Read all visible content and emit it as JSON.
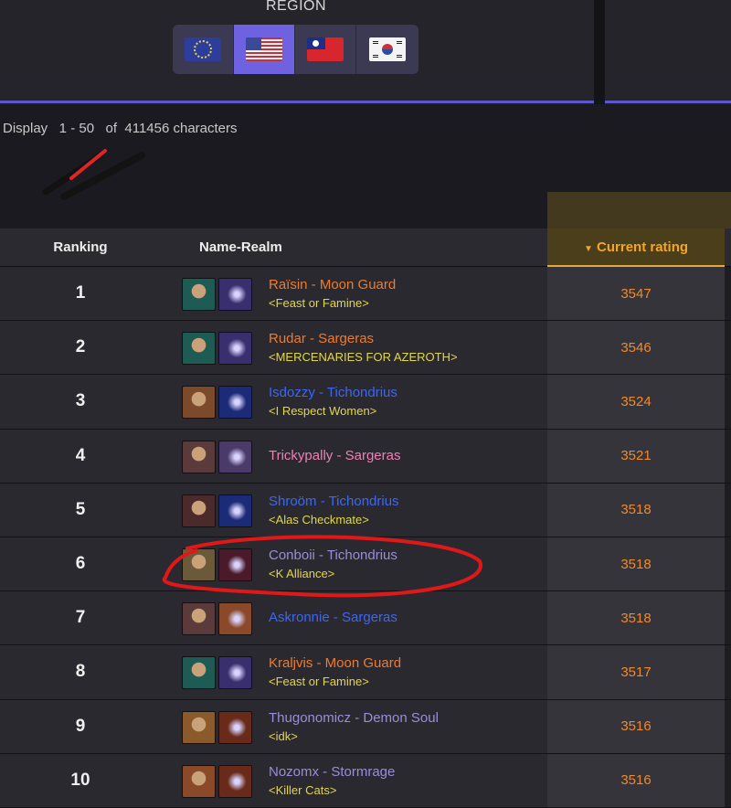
{
  "region": {
    "title": "REGION",
    "options": [
      {
        "code": "EU",
        "icon": "eu-flag-icon",
        "active": false
      },
      {
        "code": "US",
        "icon": "us-flag-icon",
        "active": true
      },
      {
        "code": "TW",
        "icon": "tw-flag-icon",
        "active": false
      },
      {
        "code": "KR",
        "icon": "kr-flag-icon",
        "active": false
      }
    ]
  },
  "display": {
    "text": "Display   1 - 50   of  411456 characters"
  },
  "table": {
    "headers": {
      "ranking": "Ranking",
      "name_realm": "Name-Realm",
      "rating": "Current rating"
    },
    "rows": [
      {
        "rank": "1",
        "name": "Raïsin - Moon Guard",
        "guild": "<Feast or Famine>",
        "rating": "3547",
        "color": "#f07a2c",
        "p1": "#1f5b55",
        "p2": "#3a2f6e"
      },
      {
        "rank": "2",
        "name": "Rudar - Sargeras",
        "guild": "<MERCENARIES FOR AZEROTH>",
        "rating": "3546",
        "color": "#f07a2c",
        "p1": "#1f5b55",
        "p2": "#3a2f6e"
      },
      {
        "rank": "3",
        "name": "Isdozzy - Tichondrius",
        "guild": "<I Respect Women>",
        "rating": "3524",
        "color": "#3d67f0",
        "p1": "#7a4a2a",
        "p2": "#1c2b78"
      },
      {
        "rank": "4",
        "name": "Trickypally - Sargeras",
        "guild": "",
        "rating": "3521",
        "color": "#f27fb6",
        "p1": "#5a3a3a",
        "p2": "#4a3a6a"
      },
      {
        "rank": "5",
        "name": "Shroöm - Tichondrius",
        "guild": "<Alas Checkmate>",
        "rating": "3518",
        "color": "#3d67f0",
        "p1": "#4a2a2a",
        "p2": "#1c2b78"
      },
      {
        "rank": "6",
        "name": "Conboii - Tichondrius",
        "guild": "<K Alliance>",
        "rating": "3518",
        "color": "#9b8dd8",
        "p1": "#6a5a3a",
        "p2": "#4a1a2a"
      },
      {
        "rank": "7",
        "name": "Askronnie - Sargeras",
        "guild": "",
        "rating": "3518",
        "color": "#3d67f0",
        "p1": "#5a3a3a",
        "p2": "#8a4a2a"
      },
      {
        "rank": "8",
        "name": "Kraljvis - Moon Guard",
        "guild": "<Feast or Famine>",
        "rating": "3517",
        "color": "#f07a2c",
        "p1": "#1f5b55",
        "p2": "#3a2f6e"
      },
      {
        "rank": "9",
        "name": "Thugonomicz - Demon Soul",
        "guild": "<idk>",
        "rating": "3516",
        "color": "#9b8dd8",
        "p1": "#8a5a2a",
        "p2": "#6a2a1a"
      },
      {
        "rank": "10",
        "name": "Nozomx - Stormrage",
        "guild": "<Killer Cats>",
        "rating": "3516",
        "color": "#9b8dd8",
        "p1": "#8a4a2a",
        "p2": "#6a2a1a"
      }
    ]
  }
}
